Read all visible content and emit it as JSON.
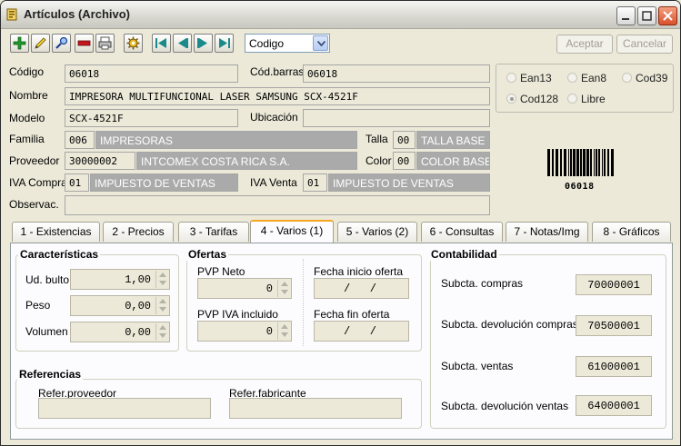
{
  "window": {
    "title": "Artículos (Archivo)"
  },
  "toolbar": {
    "icons": [
      "add-icon",
      "edit-icon",
      "search-icon",
      "delete-icon",
      "print-icon",
      "settings-icon",
      "first-record-icon",
      "previous-record-icon",
      "next-record-icon",
      "last-record-icon"
    ],
    "search_field": "Codigo",
    "accept_label": "Aceptar",
    "cancel_label": "Cancelar"
  },
  "form": {
    "codigo_label": "Código",
    "codigo_value": "06018",
    "codbarras_label": "Cód.barras",
    "codbarras_value": "06018",
    "nombre_label": "Nombre",
    "nombre_value": "IMPRESORA MULTIFUNCIONAL LASER SAMSUNG SCX-4521F",
    "modelo_label": "Modelo",
    "modelo_value": "SCX-4521F",
    "ubicacion_label": "Ubicación",
    "ubicacion_value": "",
    "familia_label": "Familia",
    "familia_code": "006",
    "familia_name": "IMPRESORAS",
    "talla_label": "Talla",
    "talla_code": "00",
    "talla_name": "TALLA BASE",
    "proveedor_label": "Proveedor",
    "proveedor_code": "30000002",
    "proveedor_name": "INTCOMEX COSTA RICA S.A.",
    "color_label": "Color",
    "color_code": "00",
    "color_name": "COLOR BASE",
    "ivacompra_label": "IVA Compra",
    "ivacompra_code": "01",
    "ivacompra_name": "IMPUESTO DE VENTAS",
    "ivaventa_label": "IVA Venta",
    "ivaventa_code": "01",
    "ivaventa_name": "IMPUESTO DE VENTAS",
    "observ_label": "Observac."
  },
  "barcode_type": {
    "options": [
      "Ean13",
      "Ean8",
      "Cod39",
      "Cod128",
      "Libre"
    ],
    "selected": "Cod128"
  },
  "barcode_text": "06018",
  "tabs": [
    "1 - Existencias",
    "2 - Precios",
    "3 - Tarifas",
    "4 - Varios (1)",
    "5 - Varios (2)",
    "6 - Consultas",
    "7 - Notas/Img",
    "8 - Gráficos"
  ],
  "active_tab": "4 - Varios (1)",
  "caracteristicas": {
    "title": "Características",
    "ud_bulto_label": "Ud. bulto",
    "ud_bulto_value": "1,00",
    "peso_label": "Peso",
    "peso_value": "0,00",
    "volumen_label": "Volumen",
    "volumen_value": "0,00"
  },
  "ofertas": {
    "title": "Ofertas",
    "pvp_neto_label": "PVP Neto",
    "pvp_neto_value": "0",
    "pvp_iva_label": "PVP IVA incluido",
    "pvp_iva_value": "0",
    "fecha_inicio_label": "Fecha inicio oferta",
    "fecha_inicio_value": "/   /",
    "fecha_fin_label": "Fecha fin oferta",
    "fecha_fin_value": "/   /"
  },
  "contabilidad": {
    "title": "Contabilidad",
    "compras_label": "Subcta. compras",
    "compras_value": "70000001",
    "dev_compras_label": "Subcta. devolución compras",
    "dev_compras_value": "70500001",
    "ventas_label": "Subcta. ventas",
    "ventas_value": "61000001",
    "dev_ventas_label": "Subcta. devolución ventas",
    "dev_ventas_value": "64000001"
  },
  "referencias": {
    "title": "Referencias",
    "proveedor_label": "Refer.proveedor",
    "proveedor_value": "",
    "fabricante_label": "Refer.fabricante",
    "fabricante_value": ""
  }
}
